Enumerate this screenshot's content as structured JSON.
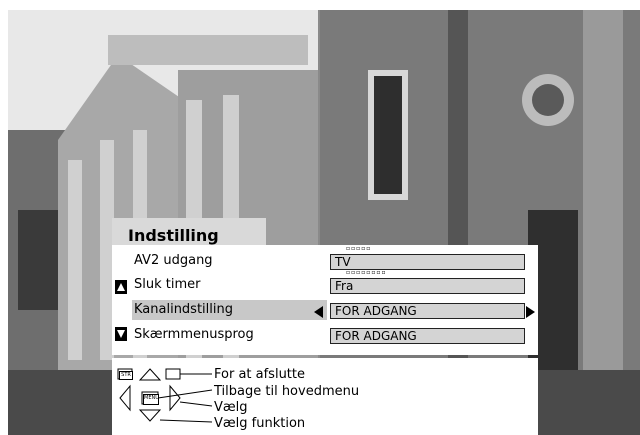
{
  "menu": {
    "title": "Indstilling",
    "rows": [
      {
        "label": "AV2 udgang",
        "value": "TV"
      },
      {
        "label": "Sluk timer",
        "value": "Fra"
      },
      {
        "label": "Kanalindstilling",
        "value": "FOR ADGANG"
      },
      {
        "label": "Skærmmenusprog",
        "value": "FOR ADGANG"
      }
    ],
    "selected_row": 2
  },
  "help": {
    "exit": "For at afslutte",
    "back": "Tilbage til hovedmenu",
    "select": "Vælg",
    "function": "Vælg funktion",
    "key_str": "STR",
    "key_menu": "MENU"
  },
  "icons": {
    "scroll_up": "up-triangle-icon",
    "scroll_down": "down-triangle-icon",
    "value_left": "left-arrow-icon",
    "value_right": "right-arrow-icon"
  }
}
